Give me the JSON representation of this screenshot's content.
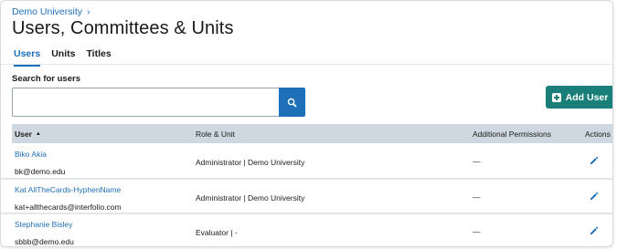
{
  "breadcrumb": {
    "parent": "Demo University",
    "separator": "›"
  },
  "page": {
    "title": "Users, Committees & Units"
  },
  "tabs": [
    {
      "label": "Users",
      "active": true
    },
    {
      "label": "Units",
      "active": false
    },
    {
      "label": "Titles",
      "active": false
    }
  ],
  "search": {
    "label": "Search for users",
    "value": "",
    "placeholder": ""
  },
  "actions": {
    "add_user_label": "Add User"
  },
  "table": {
    "columns": {
      "user": "User",
      "role_unit": "Role & Unit",
      "permissions": "Additional Permissions",
      "actions": "Actions"
    },
    "sort_indicator": "▲",
    "rows": [
      {
        "name": "Biko Akia",
        "email": "bk@demo.edu",
        "role_unit": "Administrator | Demo University",
        "permissions": "—"
      },
      {
        "name": "Kat AllTheCards-HyphenName",
        "email": "kat+allthecards@interfolio.com",
        "role_unit": "Administrator | Demo University",
        "permissions": "—"
      },
      {
        "name": "Stephanie Bisley",
        "email": "sbbb@demo.edu",
        "role_unit": "Evaluator | -",
        "permissions": "—"
      }
    ]
  },
  "colors": {
    "link": "#1d6fb8",
    "primary_button": "#1a7f78",
    "search_button": "#1d6fb8",
    "table_header_bg": "#cfd8e0"
  },
  "icons": {
    "breadcrumb_separator": "chevron-right-icon",
    "search": "search-icon",
    "add": "plus-square-icon",
    "sort": "sort-ascending-icon",
    "edit": "pencil-icon"
  }
}
